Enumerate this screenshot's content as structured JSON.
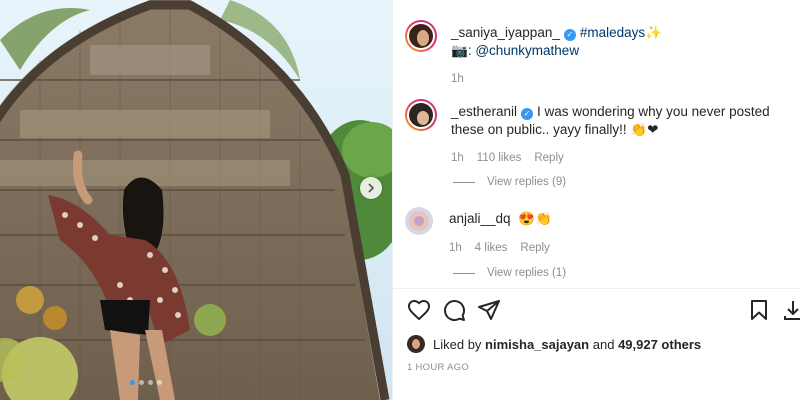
{
  "post": {
    "author": "_saniya_iyappan_",
    "caption_hashtag": "#maledays",
    "caption_sparkle": "✨",
    "camera_emoji": "📷",
    "caption_mention": ": @chunkymathew",
    "time": "1h",
    "image_count": 4,
    "active_image": 1
  },
  "comments": [
    {
      "username": "_estheranil",
      "verified": true,
      "text": "I was wondering why you never posted these on public.. yayy finally!!",
      "emojis": "👏❤",
      "time": "1h",
      "likes": "110 likes",
      "reply_label": "Reply",
      "view_replies": "View replies (9)"
    },
    {
      "username": "anjali__dq",
      "verified": false,
      "text": "",
      "emojis": "😍👏",
      "time": "1h",
      "likes": "4 likes",
      "reply_label": "Reply",
      "view_replies": "View replies (1)"
    }
  ],
  "footer": {
    "liked_prefix": "Liked by",
    "liked_user": "nimisha_sajayan",
    "liked_and": "and",
    "liked_count": "49,927 others",
    "time_ago": "1 HOUR AGO"
  },
  "icons": [
    "heart-icon",
    "comment-icon",
    "share-icon",
    "bookmark-icon",
    "next-arrow-icon",
    "verified-icon"
  ],
  "colors": {
    "link": "#00376b",
    "muted": "#8e8e8e",
    "verified": "#3897f0",
    "text": "#262626"
  }
}
